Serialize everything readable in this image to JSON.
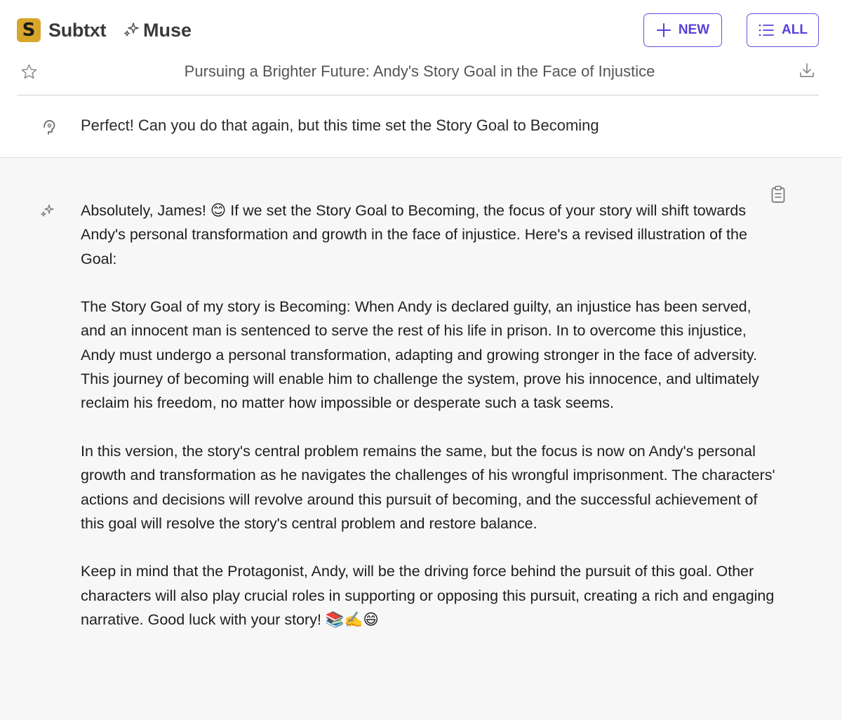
{
  "header": {
    "logo_letter": "S",
    "brand_name": "Subtxt",
    "product_name": "Muse",
    "new_button_label": "NEW",
    "all_button_label": "ALL"
  },
  "conversation": {
    "title": "Pursuing a Brighter Future: Andy's Story Goal in the Face of Injustice"
  },
  "user_message": {
    "text": "Perfect! Can you do that again, but this time set the Story Goal to Becoming"
  },
  "assistant_message": {
    "paragraphs": [
      "Absolutely, James! 😊 If we set the Story Goal to Becoming, the focus of your story will shift towards Andy's personal transformation and growth in the face of injustice. Here's a revised illustration of the Goal:",
      "The Story Goal of my story is Becoming: When Andy is declared guilty, an injustice has been served, and an innocent man is sentenced to serve the rest of his life in prison. In to overcome this injustice, Andy must undergo a personal transformation, adapting and growing stronger in the face of adversity. This journey of becoming will enable him to challenge the system, prove his innocence, and ultimately reclaim his freedom, no matter how impossible or desperate such a task seems.",
      "In this version, the story's central problem remains the same, but the focus is now on Andy's personal growth and transformation as he navigates the challenges of his wrongful imprisonment. The characters' actions and decisions will revolve around this pursuit of becoming, and the successful achievement of this goal will resolve the story's central problem and restore balance.",
      "Keep in mind that the Protagonist, Andy, will be the driving force behind the pursuit of this goal. Other characters will also play crucial roles in supporting or opposing this pursuit, creating a rich and engaging narrative. Good luck with your story! 📚✍️😄"
    ]
  },
  "colors": {
    "accent": "#5b3fd9",
    "logo_bg": "#d8a62b",
    "assistant_bg": "#f7f7f7"
  },
  "icons": {
    "brand": "sparkle-icon",
    "new": "plus-icon",
    "all": "list-icon",
    "favorite": "star-icon",
    "download": "download-icon",
    "user": "user-prompt-icon",
    "assistant": "sparkle-icon",
    "copy": "clipboard-icon"
  }
}
